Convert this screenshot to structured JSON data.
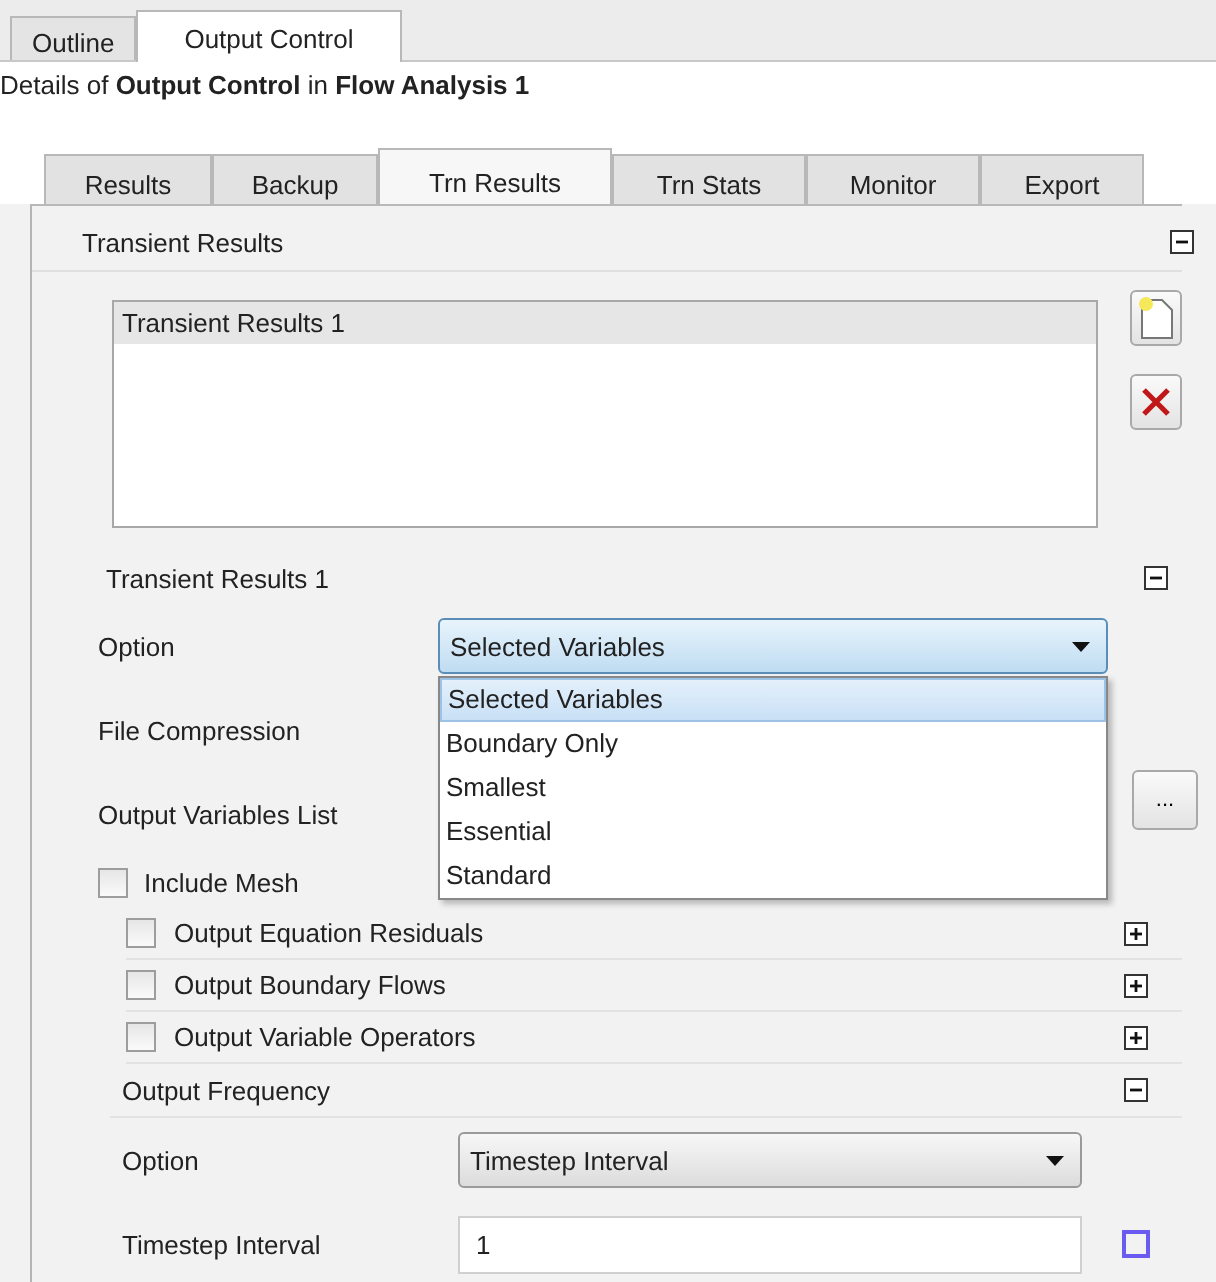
{
  "outer_tabs": [
    {
      "label": "Outline",
      "selected": false
    },
    {
      "label": "Output Control",
      "selected": true
    }
  ],
  "details_title": "Details of **Output Control** in **Flow Analysis 1**",
  "inner_tabs": [
    {
      "label": "Results",
      "selected": false
    },
    {
      "label": "Backup",
      "selected": false
    },
    {
      "label": "Trn Results",
      "selected": true
    },
    {
      "label": "Trn Stats",
      "selected": false
    },
    {
      "label": "Monitor",
      "selected": false
    },
    {
      "label": "Export",
      "selected": false
    }
  ],
  "transient_results": {
    "title": "Transient Results",
    "expanded": true,
    "items": [
      {
        "label": "Transient Results 1",
        "selected": true
      }
    ]
  },
  "detail": {
    "title": "Transient Results 1",
    "expanded": true,
    "fields": [
      {
        "kind": "select",
        "label": "Option",
        "value": "Selected Variables",
        "open": true,
        "options": [
          {
            "label": "Selected Variables",
            "selected": true
          },
          {
            "label": "Boundary Only",
            "selected": false
          },
          {
            "label": "Smallest",
            "selected": false
          },
          {
            "label": "Essential",
            "selected": false
          },
          {
            "label": "Standard",
            "selected": false
          }
        ]
      },
      {
        "kind": "hidden",
        "label": "File Compression"
      },
      {
        "kind": "browse",
        "label": "Output Variables List",
        "button": "..."
      }
    ],
    "include_mesh": {
      "label": "Include Mesh",
      "checked": false
    },
    "subsections": [
      {
        "label": "Output Equation Residuals",
        "checked": false,
        "expanded": false
      },
      {
        "label": "Output Boundary Flows",
        "checked": false,
        "expanded": false
      },
      {
        "label": "Output Variable Operators",
        "checked": false,
        "expanded": false
      }
    ],
    "frequency": {
      "title": "Output Frequency",
      "expanded": true,
      "fields": [
        {
          "kind": "select",
          "label": "Option",
          "value": "Timestep Interval",
          "open": false
        },
        {
          "kind": "input",
          "label": "Timestep Interval",
          "value": "1"
        }
      ]
    }
  }
}
